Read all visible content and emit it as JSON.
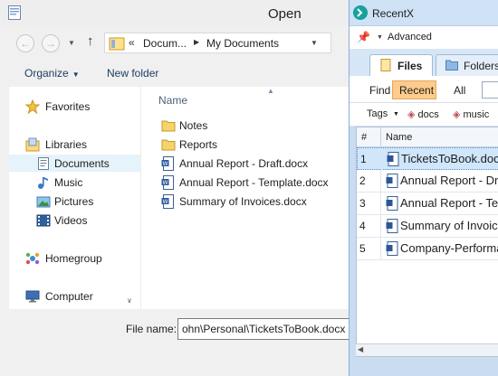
{
  "open_dialog": {
    "title": "Open",
    "address": {
      "chevrons": "«",
      "segments": [
        "Docum...",
        "My Documents"
      ]
    },
    "toolbar": {
      "organize_label": "Organize",
      "new_folder_label": "New folder"
    },
    "nav": {
      "favorites": "Favorites",
      "libraries": "Libraries",
      "documents": "Documents",
      "music": "Music",
      "pictures": "Pictures",
      "videos": "Videos",
      "homegroup": "Homegroup",
      "computer": "Computer"
    },
    "file_list": {
      "column_name": "Name",
      "items": [
        {
          "name": "Notes",
          "type": "folder"
        },
        {
          "name": "Reports",
          "type": "folder"
        },
        {
          "name": "Annual Report - Draft.docx",
          "type": "docx"
        },
        {
          "name": "Annual Report - Template.docx",
          "type": "docx"
        },
        {
          "name": "Summary of Invoices.docx",
          "type": "docx"
        }
      ]
    },
    "filename": {
      "label": "File name:",
      "value": "ohn\\Personal\\TicketsToBook.docx"
    }
  },
  "recentx": {
    "title": "RecentX",
    "advanced_label": "Advanced",
    "tabs": [
      {
        "label": "Files",
        "active": true
      },
      {
        "label": "Folders",
        "active": false
      }
    ],
    "filter": {
      "find_label": "Find",
      "recent_label": "Recent",
      "all_label": "All"
    },
    "tags": {
      "label": "Tags",
      "items": [
        "docs",
        "music"
      ]
    },
    "table": {
      "header_num": "#",
      "header_name": "Name",
      "rows": [
        {
          "num": "1",
          "name": "TicketsToBook.docx",
          "selected": true
        },
        {
          "num": "2",
          "name": "Annual Report - Draft",
          "selected": false
        },
        {
          "num": "3",
          "name": "Annual Report - Template",
          "selected": false
        },
        {
          "num": "4",
          "name": "Summary of Invoices",
          "selected": false
        },
        {
          "num": "5",
          "name": "Company-Performance",
          "selected": false
        }
      ]
    }
  },
  "colors": {
    "accent_recent": "#fdcb8c",
    "selection": "#cfe6fb",
    "nav_selected": "#e5f3fb",
    "panel_bg": "#c9dcf0"
  }
}
